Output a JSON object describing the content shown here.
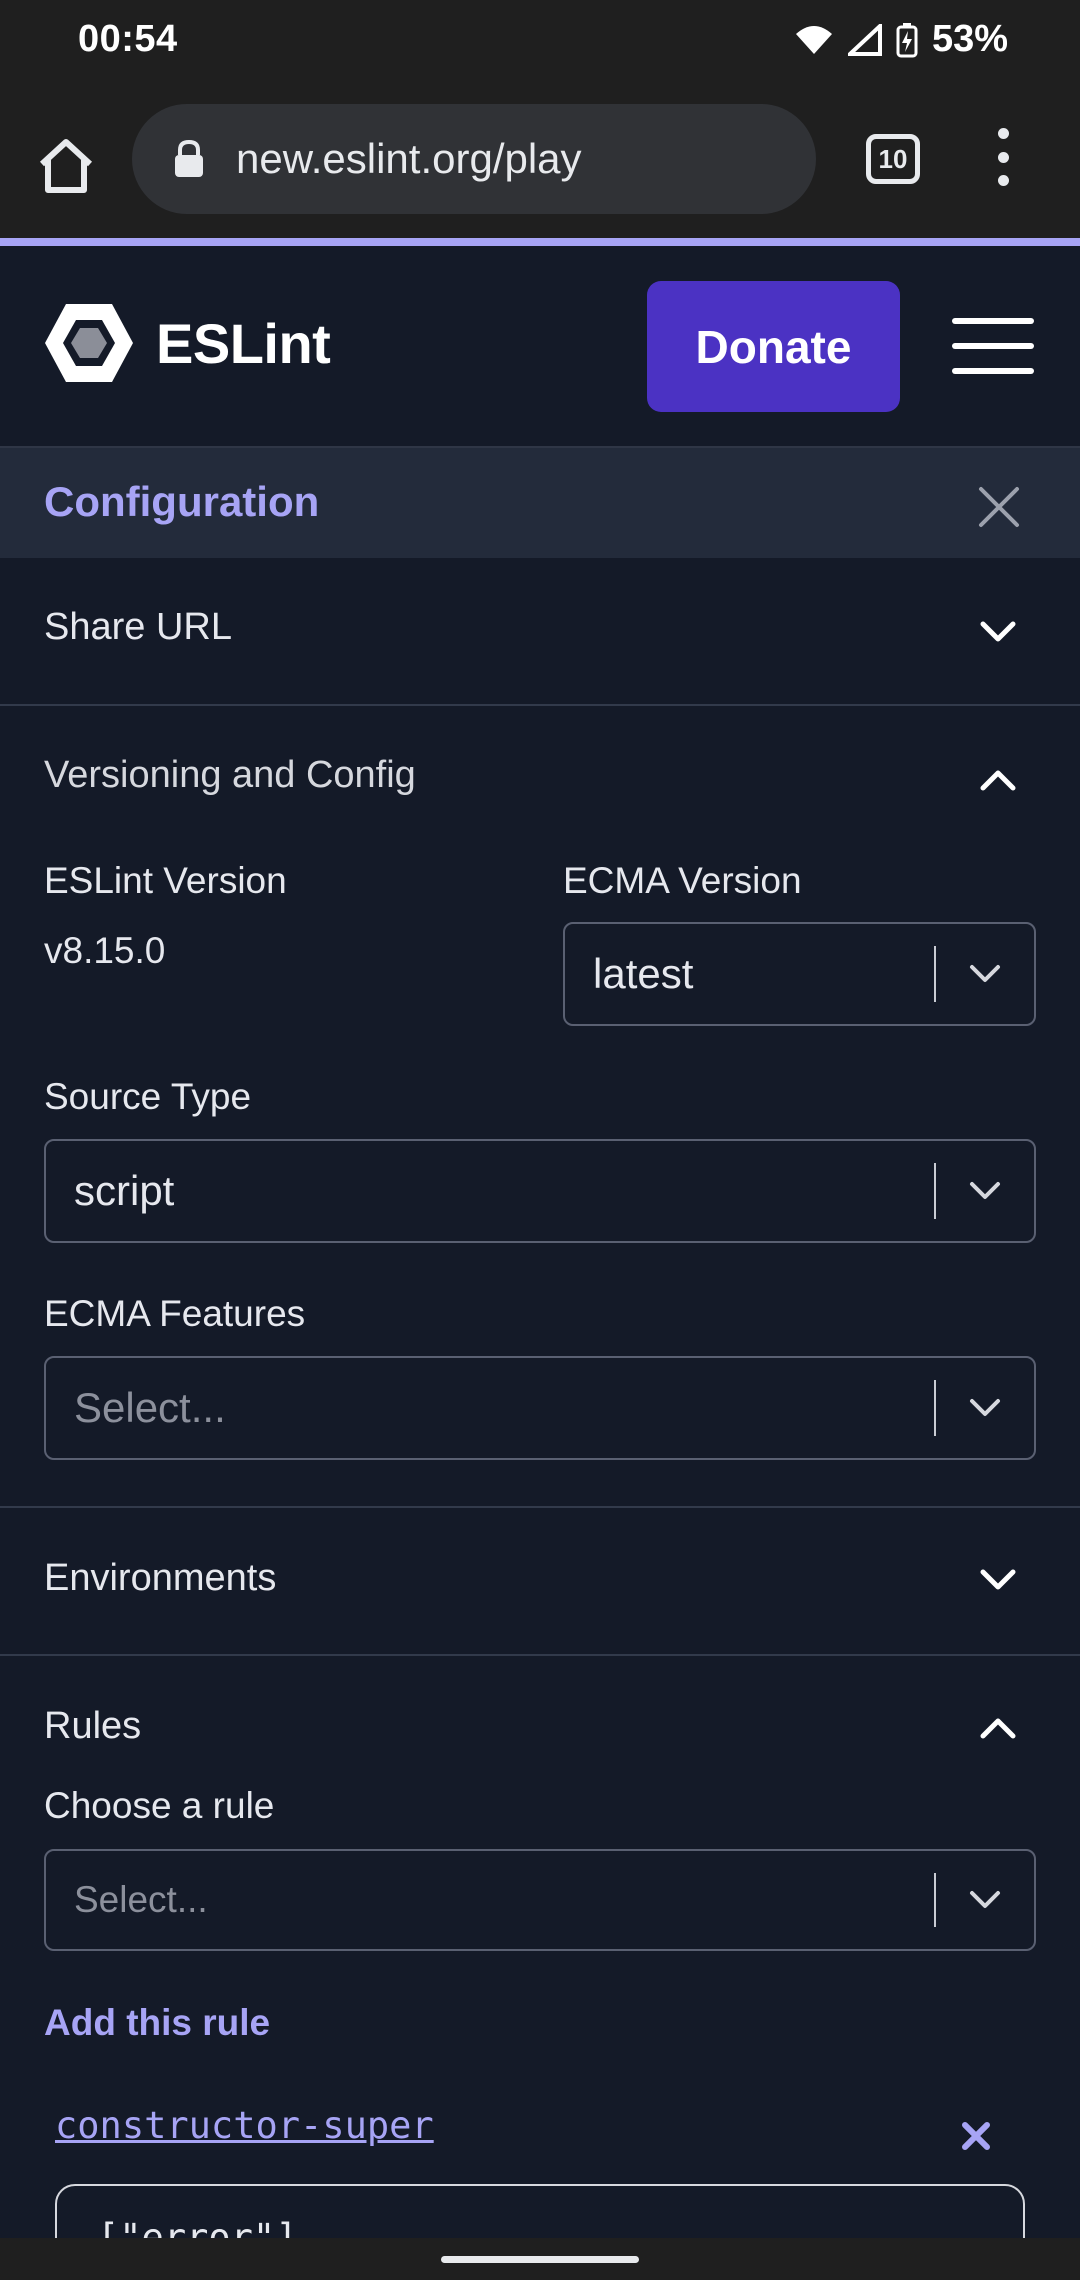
{
  "status_bar": {
    "time": "00:54",
    "battery": "53%"
  },
  "browser": {
    "url": "new.eslint.org/play",
    "tab_count": "10"
  },
  "header": {
    "logo_text": "ESLint",
    "donate_label": "Donate"
  },
  "config": {
    "title": "Configuration"
  },
  "sections": {
    "share_url": "Share URL",
    "versioning": "Versioning and Config",
    "environments": "Environments",
    "rules": "Rules"
  },
  "versioning": {
    "eslint_version_label": "ESLint Version",
    "eslint_version_value": "v8.15.0",
    "ecma_version_label": "ECMA Version",
    "ecma_version_value": "latest",
    "source_type_label": "Source Type",
    "source_type_value": "script",
    "ecma_features_label": "ECMA Features",
    "ecma_features_placeholder": "Select..."
  },
  "rules": {
    "choose_label": "Choose a rule",
    "choose_placeholder": "Select...",
    "add_label": "Add this rule",
    "items": [
      {
        "name": "constructor-super",
        "config_preview": "[\"error\"]"
      }
    ]
  },
  "colors": {
    "accent": "#a7a4f5",
    "donate": "#4b32c3",
    "background": "#141a28"
  }
}
